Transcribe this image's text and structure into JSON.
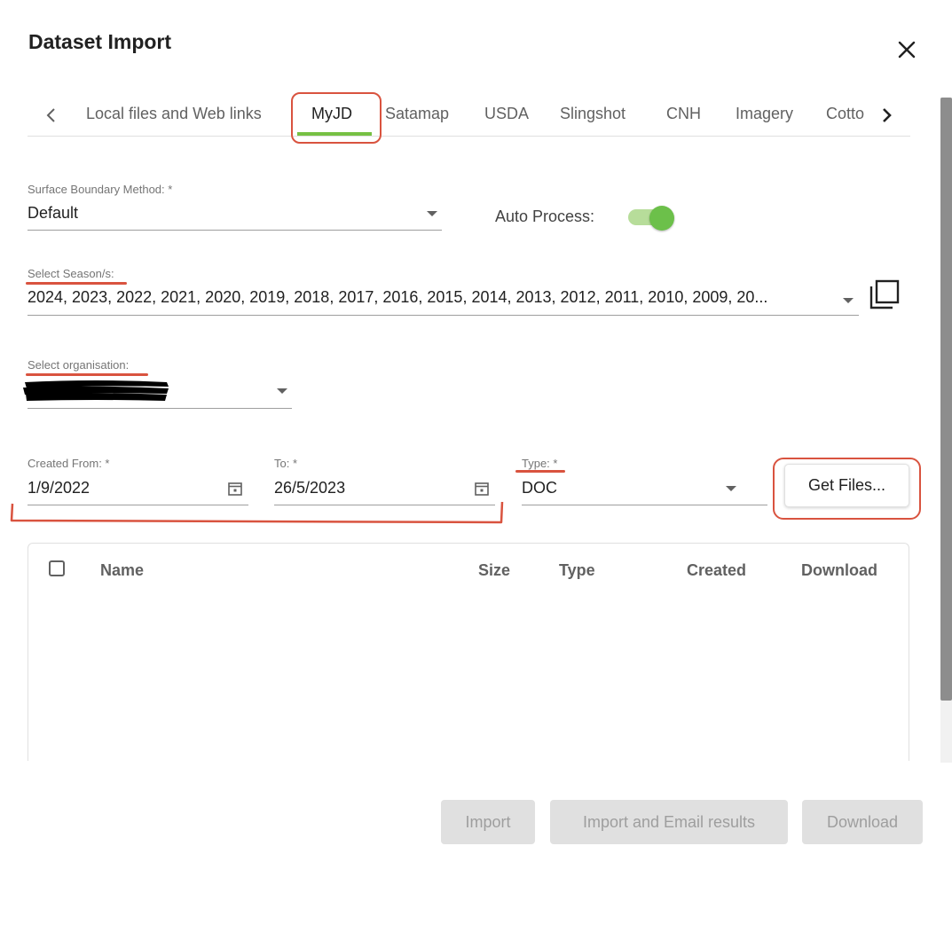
{
  "dialog": {
    "title": "Dataset Import",
    "close_icon": "close-icon"
  },
  "tabs": {
    "prev_icon": "chevron-left-icon",
    "next_icon": "chevron-right-icon",
    "items": [
      {
        "label": "Local files and Web links"
      },
      {
        "label": "MyJD",
        "active": true
      },
      {
        "label": "Satamap"
      },
      {
        "label": "USDA"
      },
      {
        "label": "Slingshot"
      },
      {
        "label": "CNH"
      },
      {
        "label": "Imagery"
      },
      {
        "label": "Cotto"
      }
    ],
    "active_color": "#76c043"
  },
  "form": {
    "surface_boundary": {
      "label": "Surface Boundary Method: *",
      "value": "Default"
    },
    "auto_process": {
      "label": "Auto Process:",
      "checked": true
    },
    "season": {
      "label": "Select Season/s:",
      "value": "2024, 2023, 2022, 2021, 2020, 2019, 2018, 2017, 2016, 2015, 2014, 2013, 2012, 2011, 2010, 2009, 20...",
      "copy_icon": "copy-icon"
    },
    "organisation": {
      "label": "Select organisation:",
      "value_redacted": true
    },
    "created_from": {
      "label": "Created From: *",
      "value": "1/9/2022",
      "icon": "calendar-icon"
    },
    "to": {
      "label": "To: *",
      "value": "26/5/2023",
      "icon": "calendar-icon"
    },
    "type": {
      "label": "Type: *",
      "value": "DOC"
    },
    "get_files": "Get Files..."
  },
  "table": {
    "columns": [
      "Name",
      "Size",
      "Type",
      "Created",
      "Download"
    ],
    "rows": []
  },
  "actions": {
    "import": "Import",
    "import_email": "Import and Email results",
    "download": "Download"
  },
  "colors": {
    "accent": "#76c043",
    "annotation": "#d9533f",
    "disabled_bg": "#e0e0e0"
  }
}
